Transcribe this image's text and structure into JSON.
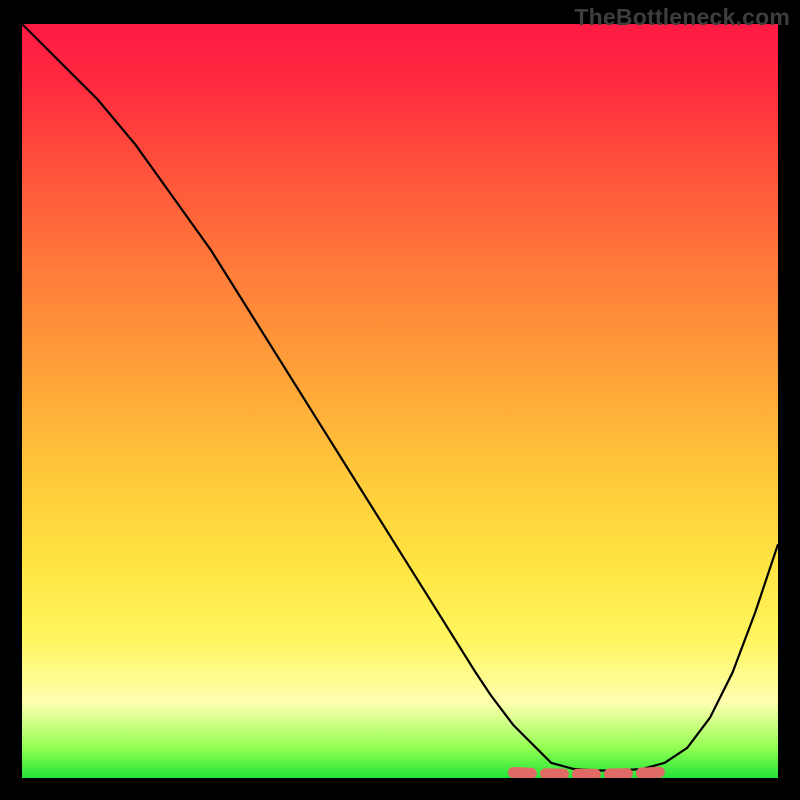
{
  "watermark": "TheBottleneck.com",
  "colors": {
    "gradient_top": "#ff1a44",
    "gradient_bottom": "#22e437",
    "curve": "#000000",
    "highlight": "#e06a65",
    "background": "#000000"
  },
  "chart_data": {
    "type": "line",
    "title": "",
    "xlabel": "",
    "ylabel": "",
    "xlim": [
      0,
      100
    ],
    "ylim": [
      0,
      100
    ],
    "grid": false,
    "legend": false,
    "series": [
      {
        "name": "bottleneck-curve",
        "x": [
          0,
          5,
          10,
          15,
          20,
          25,
          30,
          35,
          40,
          45,
          50,
          55,
          60,
          62,
          65,
          68,
          70,
          73,
          76,
          79,
          82,
          85,
          88,
          91,
          94,
          97,
          100
        ],
        "y": [
          100,
          95,
          90,
          84,
          77,
          70,
          62,
          54,
          46,
          38,
          30,
          22,
          14,
          11,
          7,
          4,
          2,
          1.2,
          1,
          1,
          1.2,
          2,
          4,
          8,
          14,
          22,
          31
        ]
      }
    ],
    "annotations": [
      {
        "name": "optimal-zone-highlight",
        "type": "dash-segment",
        "x_range": [
          65,
          86
        ],
        "y": 1,
        "color": "#e06a65"
      }
    ]
  }
}
